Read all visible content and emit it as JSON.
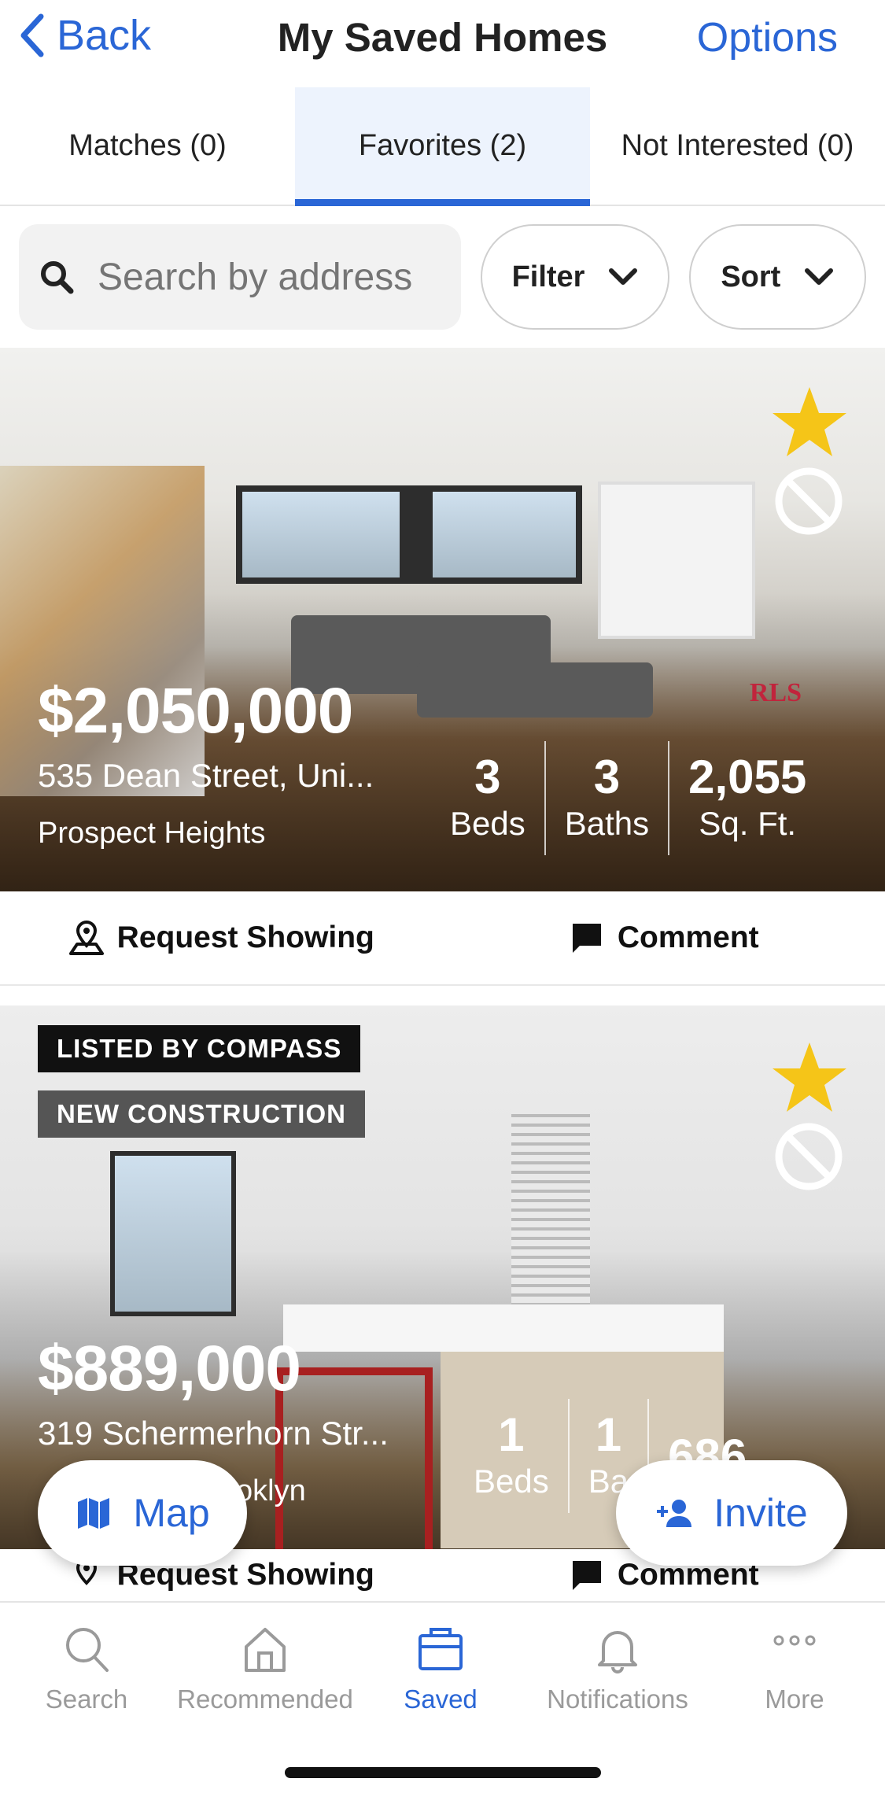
{
  "header": {
    "back_label": "Back",
    "title": "My Saved Homes",
    "options_label": "Options"
  },
  "tabs": [
    {
      "label": "Matches (0)",
      "active": false
    },
    {
      "label": "Favorites (2)",
      "active": true
    },
    {
      "label": "Not Interested (0)",
      "active": false
    }
  ],
  "search": {
    "placeholder": "Search by address",
    "filter_label": "Filter",
    "sort_label": "Sort"
  },
  "listings": [
    {
      "price": "$2,050,000",
      "address": "535 Dean Street, Uni...",
      "neighborhood": "Prospect Heights",
      "beds": "3",
      "beds_label": "Beds",
      "baths": "3",
      "baths_label": "Baths",
      "sqft": "2,055",
      "sqft_label": "Sq. Ft.",
      "watermark": "RLS",
      "favorited": true
    },
    {
      "badges": [
        "LISTED BY COMPASS",
        "NEW CONSTRUCTION"
      ],
      "price": "$889,000",
      "address": "319 Schermerhorn Str...",
      "neighborhood_visible": "oklyn",
      "beds": "1",
      "beds_label": "Beds",
      "baths": "1",
      "baths_label_visible": "Ba",
      "sqft": "686",
      "favorited": true
    }
  ],
  "actions": {
    "request_showing": "Request Showing",
    "comment": "Comment"
  },
  "fabs": {
    "map_label": "Map",
    "invite_label": "Invite"
  },
  "bottom_nav": [
    {
      "label": "Search",
      "icon": "search-icon"
    },
    {
      "label": "Recommended",
      "icon": "home-icon"
    },
    {
      "label": "Saved",
      "icon": "briefcase-icon",
      "active": true
    },
    {
      "label": "Notifications",
      "icon": "bell-icon"
    },
    {
      "label": "More",
      "icon": "more-icon"
    }
  ],
  "colors": {
    "accent": "#2a66d6",
    "star": "#f5c518",
    "tab_active_bg": "#edf3fd"
  }
}
